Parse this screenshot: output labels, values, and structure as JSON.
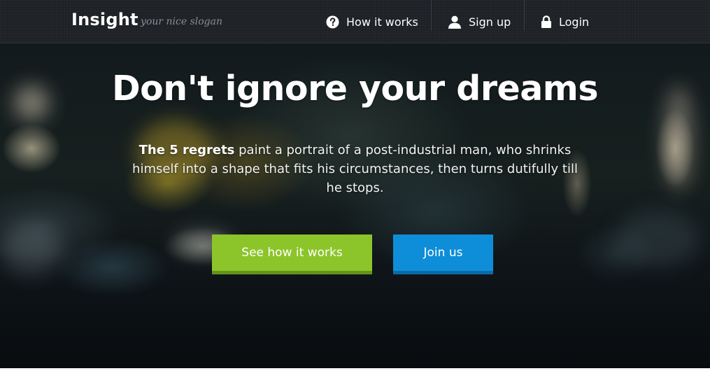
{
  "navbar": {
    "brand": "Insight",
    "slogan": "your nice slogan",
    "items": [
      {
        "label": "How it works",
        "icon": "question-circle-icon"
      },
      {
        "label": "Sign up",
        "icon": "user-icon"
      },
      {
        "label": "Login",
        "icon": "lock-icon"
      }
    ]
  },
  "hero": {
    "title": "Don't ignore your dreams",
    "lead_bold": "The 5 regrets",
    "lead_rest": " paint a portrait of a post-industrial man, who shrinks himself into a shape that fits his circumstances, then turns dutifully till he stops.",
    "buttons": {
      "primary": "See how it works",
      "secondary": "Join us"
    }
  },
  "colors": {
    "navbar_bg": "#1e2125",
    "primary_button": "#8cc52a",
    "secondary_button": "#0e8ed9"
  }
}
